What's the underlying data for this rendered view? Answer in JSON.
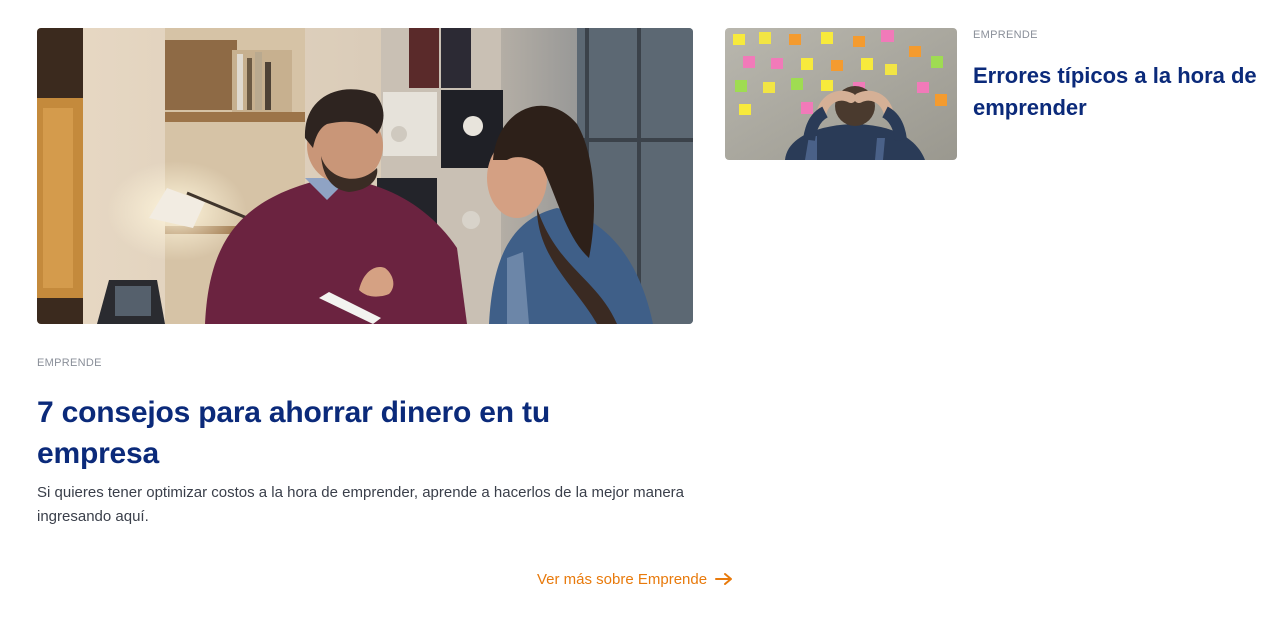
{
  "colors": {
    "title": "#0b2a7a",
    "category": "#8a8f99",
    "body_text": "#3a3f4a",
    "link": "#e87a0c"
  },
  "featured": {
    "category": "EMPRENDE",
    "title": "7 consejos para ahorrar dinero en tu empresa",
    "description": "Si quieres tener optimizar costos a la hora de emprender, aprende a hacerlos de la mejor manera ingresando aquí.",
    "image_icon": "office-conversation-photo"
  },
  "side_article": {
    "category": "EMPRENDE",
    "title": "Errores típicos a la hora de emprender",
    "image_icon": "sticky-notes-wall-photo"
  },
  "more_link": {
    "label": "Ver más sobre Emprende",
    "icon": "arrow-right-icon"
  }
}
